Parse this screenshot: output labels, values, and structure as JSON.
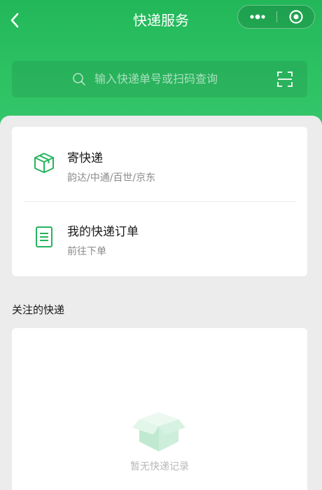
{
  "header": {
    "title": "快递服务",
    "back_icon": "chevron-left-icon",
    "capsule": {
      "more_icon": "more-dots-icon",
      "close_icon": "target-circle-icon"
    }
  },
  "search": {
    "placeholder": "输入快递单号或扫码查询",
    "scan_icon": "scan-frame-icon"
  },
  "services": [
    {
      "title": "寄快递",
      "subtitle": "韵达/中通/百世/京东",
      "icon": "package-box-icon"
    },
    {
      "title": "我的快递订单",
      "subtitle": "前往下单",
      "icon": "document-list-icon"
    }
  ],
  "followed": {
    "section_title": "关注的快递",
    "empty_text": "暂无快递记录",
    "empty_icon": "empty-box-icon"
  },
  "colors": {
    "brand_green": "#2cc163",
    "icon_green": "#26b45e",
    "page_bg": "#ececec"
  }
}
